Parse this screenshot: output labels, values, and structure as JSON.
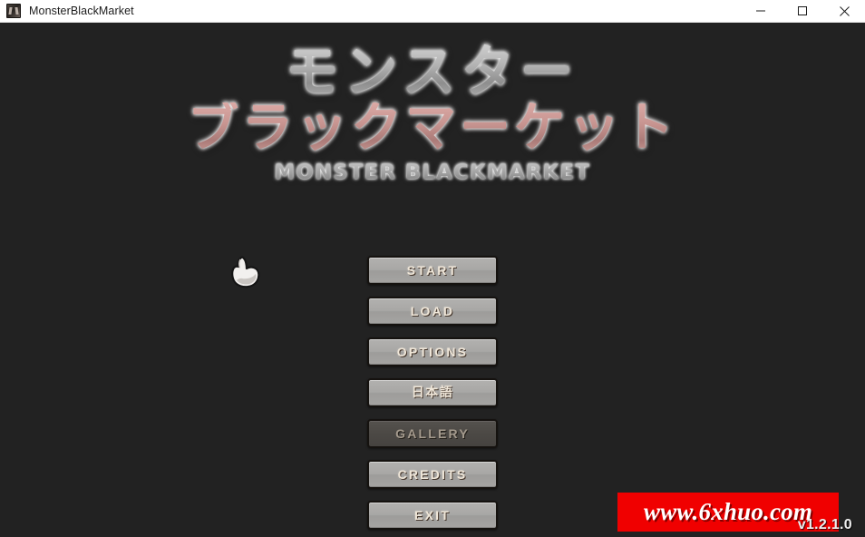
{
  "titlebar": {
    "app_icon": "monster-app-icon",
    "title": "MonsterBlackMarket",
    "minimize_label": "minimize-icon",
    "maximize_label": "maximize-icon",
    "close_label": "close-icon"
  },
  "logo": {
    "line1": "モンスター",
    "line2": "ブラックマーケット",
    "subtitle": "MONSTER BLACKMARKET",
    "line1_color": "#aaaaaa",
    "line2_color": "#c89591"
  },
  "cursor": {
    "icon": "pointing-hand-cursor"
  },
  "menu": {
    "items": [
      {
        "id": "start",
        "label": "START",
        "disabled": false
      },
      {
        "id": "load",
        "label": "LOAD",
        "disabled": false
      },
      {
        "id": "options",
        "label": "OPTIONS",
        "disabled": false
      },
      {
        "id": "language",
        "label": "日本語",
        "disabled": false
      },
      {
        "id": "gallery",
        "label": "GALLERY",
        "disabled": true
      },
      {
        "id": "credits",
        "label": "CREDITS",
        "disabled": false
      },
      {
        "id": "exit",
        "label": "EXIT",
        "disabled": false
      }
    ]
  },
  "watermark": {
    "text": "www.6xhuo.com",
    "background_color": "#f00000",
    "text_color": "#ffffff"
  },
  "version": {
    "text": "v1.2.1.0"
  },
  "theme": {
    "background_color": "#222222",
    "button_fill": "#a8a7a5",
    "button_border": "#15120f",
    "button_text": "#efe6d8",
    "disabled_fill": "#4c4945",
    "disabled_text": "#a49a8d",
    "titlebar_background": "#ffffff",
    "titlebar_text": "#1b1b1b"
  }
}
